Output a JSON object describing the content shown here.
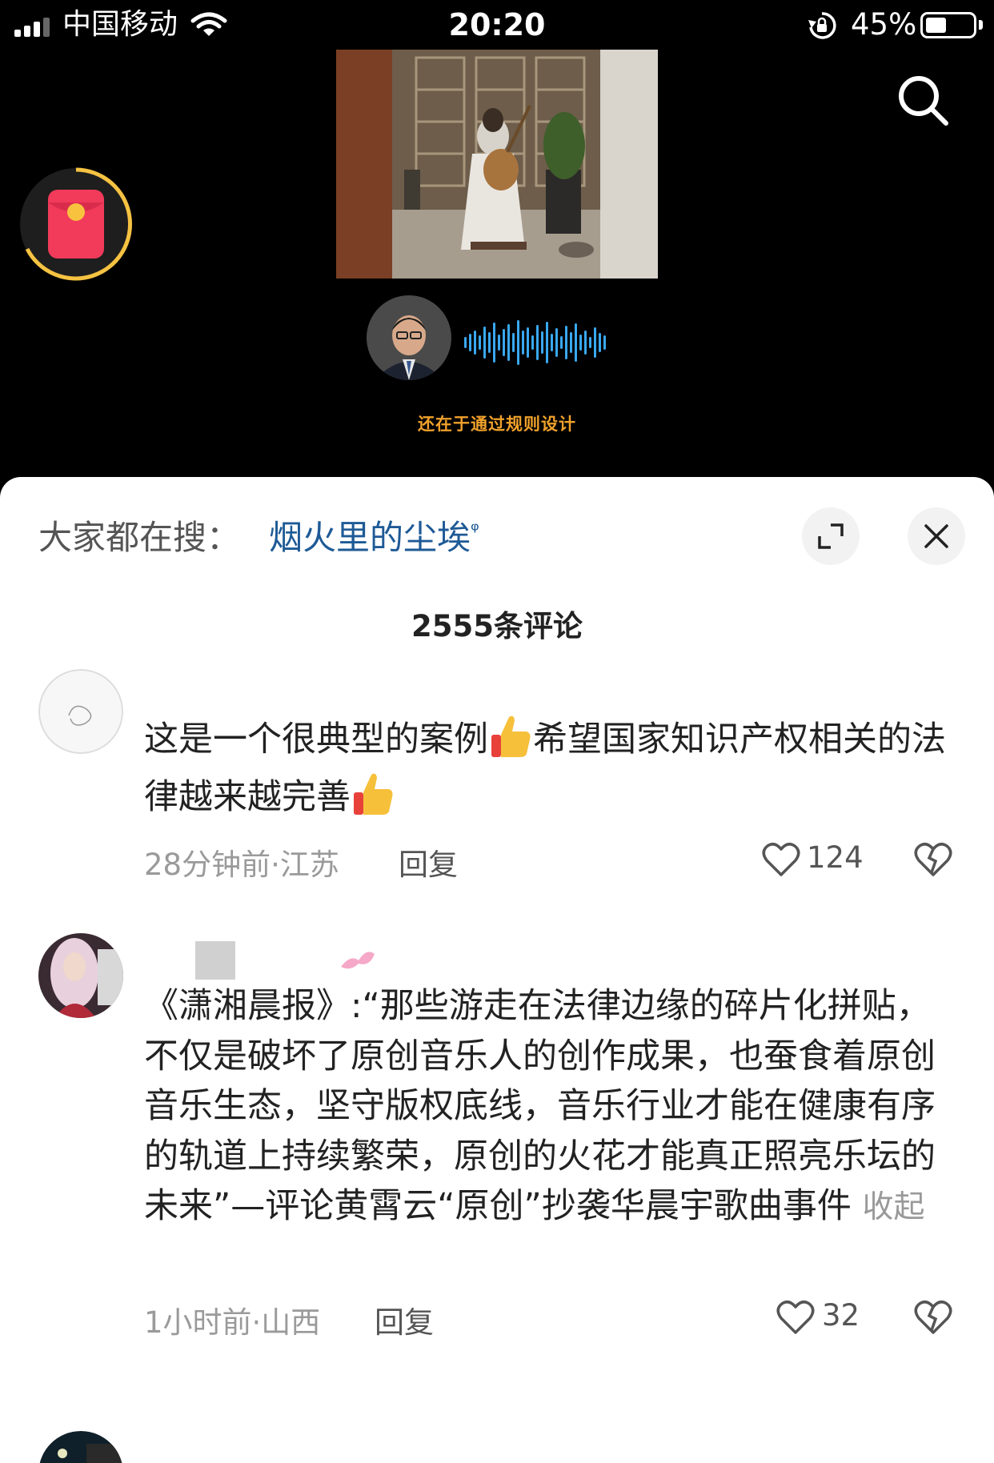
{
  "status_bar": {
    "carrier": "中国移动",
    "time": "20:20",
    "battery_percent": "45%",
    "battery_level": 0.45
  },
  "video": {
    "subtitle": "还在于通过规则设计"
  },
  "sheet": {
    "hot_search_label": "大家都在搜：",
    "hot_search_term": "烟火里的尘埃",
    "comment_count": "2555条评论"
  },
  "comments": [
    {
      "text_part1": "这是一个很典型的案例",
      "text_part2": "希望国家知识产权相关的法律越来越完善",
      "meta": "28分钟前·江苏",
      "reply_label": "回复",
      "likes": "124"
    },
    {
      "text": "《潇湘晨报》:“那些游走在法律边缘的碎片化拼贴，不仅是破坏了原创音乐人的创作成果，也蚕食着原创音乐生态，坚守版权底线，音乐行业才能在健康有序的轨道上持续繁荣，原创的火花才能真正照亮乐坛的未来”—评论黄霄云“原创”抄袭华晨宇歌曲事件",
      "collapse_label": "收起",
      "meta": "1小时前·山西",
      "reply_label": "回复",
      "likes": "32"
    }
  ],
  "icons": [
    "signal-icon",
    "wifi-icon",
    "rotation-lock-icon",
    "battery-icon",
    "search-icon",
    "red-packet-icon",
    "waveform-icon",
    "expand-icon",
    "close-icon",
    "heart-icon",
    "broken-heart-icon",
    "thumbs-up-emoji"
  ]
}
